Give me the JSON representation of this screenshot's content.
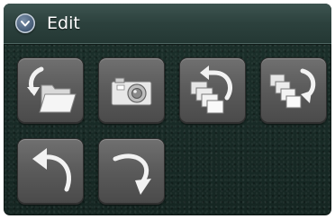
{
  "panel": {
    "title": "Edit"
  },
  "icons": {
    "collapse": "chevron-up-circle-icon",
    "open_folder": "open-folder-icon",
    "camera": "camera-icon",
    "rotate_all_left": "rotate-all-left-icon",
    "rotate_all_right": "rotate-all-right-icon",
    "rotate_left": "rotate-left-icon",
    "rotate_right": "rotate-right-icon"
  },
  "colors": {
    "header": "#2c413d",
    "background": "#1a2c28",
    "tool_button": "#5a5a5a",
    "collapse_button": "#3f5570"
  }
}
